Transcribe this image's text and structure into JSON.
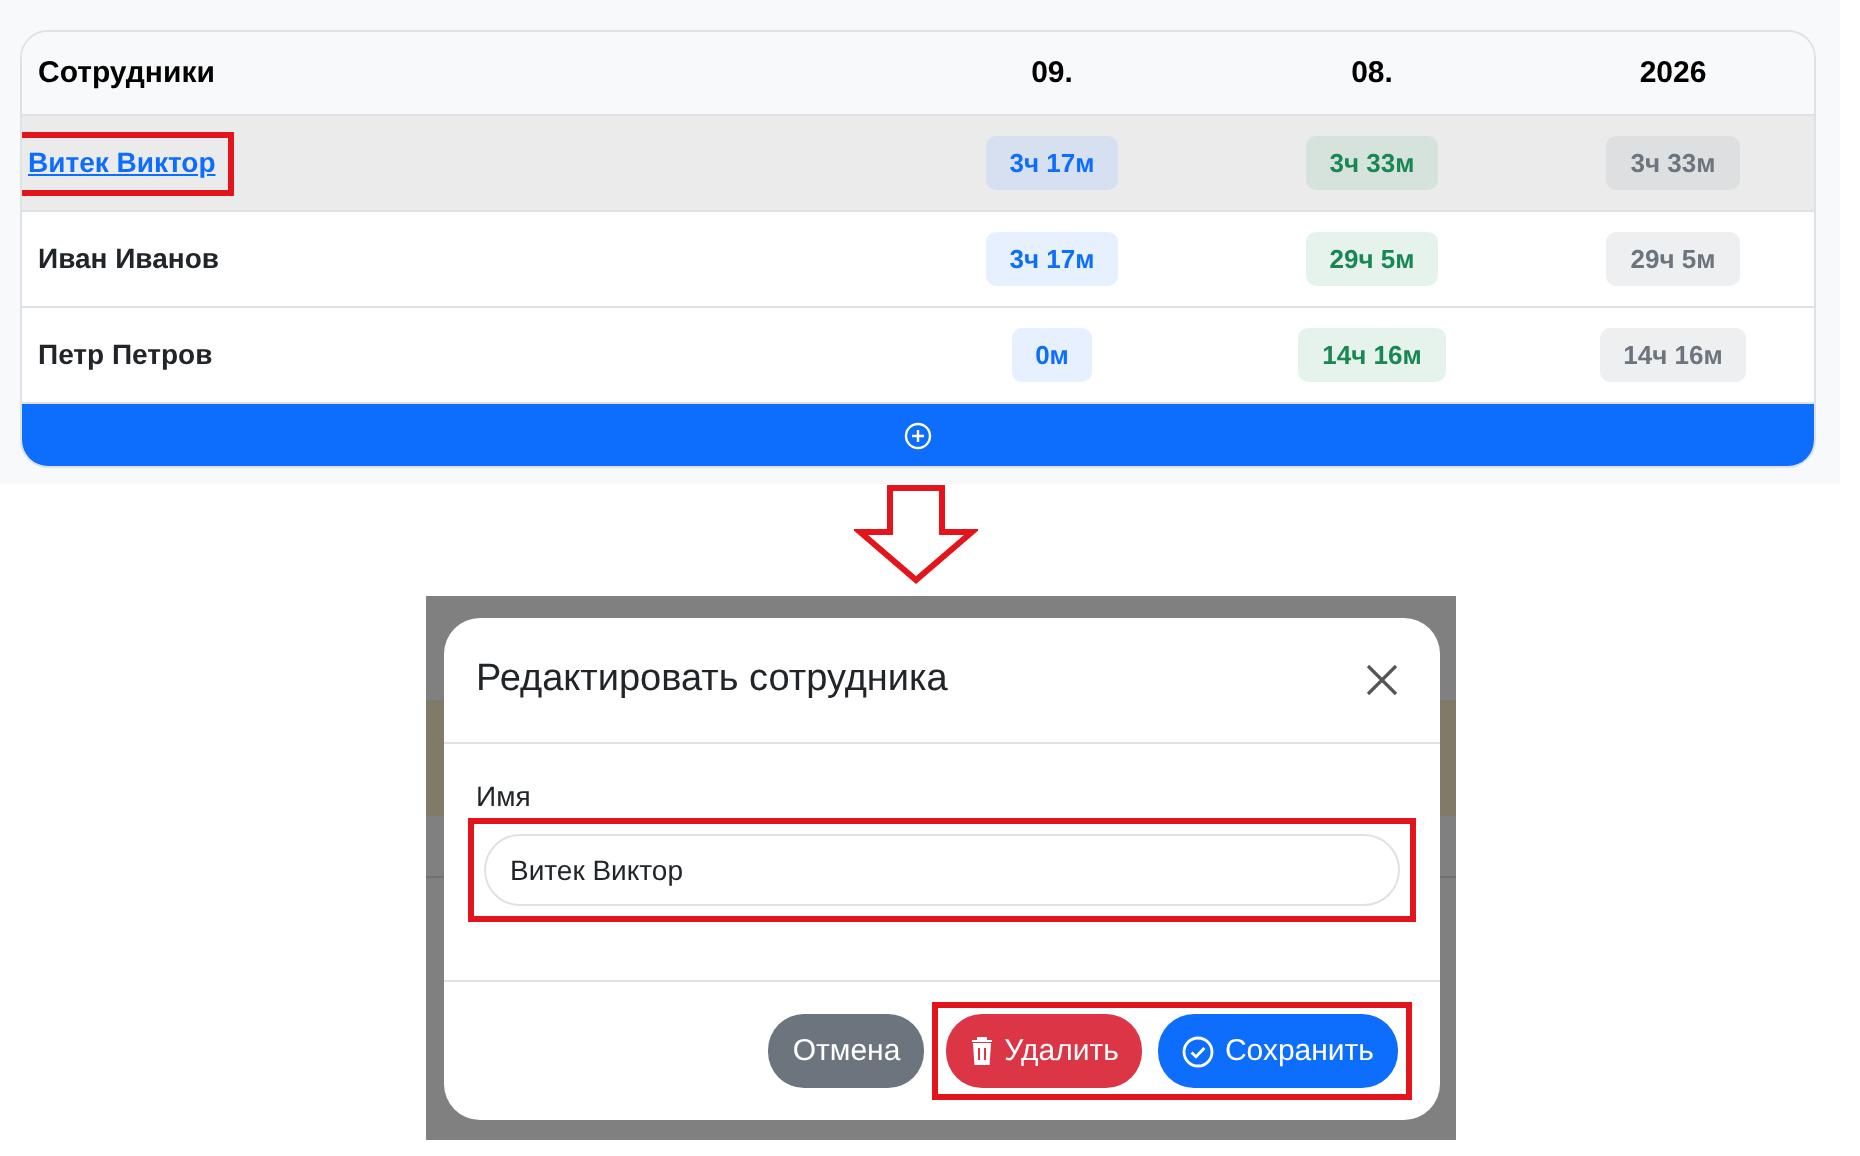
{
  "table": {
    "columns": [
      {
        "label": "Сотрудники",
        "kind": "name"
      },
      {
        "label": "09.",
        "kind": "day"
      },
      {
        "label": "08.",
        "kind": "month"
      },
      {
        "label": "2026",
        "kind": "year"
      }
    ],
    "rows": [
      {
        "link": true,
        "selected": true,
        "highlighted": true,
        "cells": [
          "Витек Виктор",
          "3ч 17м",
          "3ч 33м",
          "3ч 33м"
        ]
      },
      {
        "link": false,
        "selected": false,
        "highlighted": false,
        "cells": [
          "Иван Иванов",
          "3ч 17м",
          "29ч 5м",
          "29ч 5м"
        ]
      },
      {
        "link": false,
        "selected": false,
        "highlighted": false,
        "cells": [
          "Петр Петров",
          "0м",
          "14ч 16м",
          "14ч 16м"
        ]
      }
    ]
  },
  "modal": {
    "title": "Редактировать сотрудника",
    "field": {
      "label": "Имя",
      "value": "Витек Виктор",
      "highlighted": true
    },
    "buttons": [
      {
        "label": "Отмена",
        "kind": "cancel"
      },
      {
        "label": "Удалить",
        "kind": "delete"
      },
      {
        "label": "Сохранить",
        "kind": "save"
      }
    ],
    "actions_highlighted": true
  }
}
